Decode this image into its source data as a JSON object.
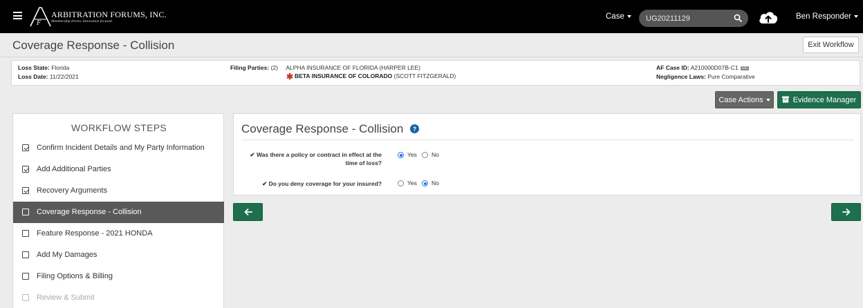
{
  "header": {
    "brand_name": "ARBITRATION FORUMS, INC.",
    "brand_tagline": "Membership driven. Innovation focused.",
    "case_menu_label": "Case",
    "search_value": "UG20211129",
    "user_menu_label": "Ben Responder"
  },
  "titlebar": {
    "title": "Coverage Response - Collision",
    "exit_label": "Exit Workflow"
  },
  "info": {
    "loss_state_label": "Loss State:",
    "loss_state_value": "Florida",
    "loss_date_label": "Loss Date:",
    "loss_date_value": "11/22/2021",
    "filing_parties_label": "Filing Parties:",
    "filing_parties_count": "(2)",
    "party1": "ALPHA INSURANCE OF FLORIDA",
    "party1_contact": "(HARPER LEE)",
    "party2": "BETA INSURANCE OF COLORADO",
    "party2_contact": "(SCOTT FITZGERALD)",
    "case_id_label": "AF Case ID:",
    "case_id_value": "A210000D07B-C1",
    "case_id_badge": "CC",
    "negligence_label": "Negligence Laws:",
    "negligence_value": "Pure Comparative"
  },
  "actions": {
    "case_actions_label": "Case Actions",
    "evidence_label": "Evidence Manager"
  },
  "sidebar": {
    "heading": "WORKFLOW STEPS",
    "steps": [
      {
        "label": "Confirm Incident Details and My Party Information",
        "checked": true
      },
      {
        "label": "Add Additional Parties",
        "checked": true
      },
      {
        "label": "Recovery Arguments",
        "checked": true
      },
      {
        "label": "Coverage Response - Collision",
        "checked": false,
        "active": true
      },
      {
        "label": "Feature Response - 2021 HONDA",
        "checked": false
      },
      {
        "label": "Add My Damages",
        "checked": false
      },
      {
        "label": "Filing Options & Billing",
        "checked": false
      },
      {
        "label": "Review & Submit",
        "checked": false,
        "disabled": true
      }
    ]
  },
  "panel": {
    "title": "Coverage Response - Collision",
    "q1_line1": "Was there a policy or contract in effect at the",
    "q1_line2": "time of loss?",
    "q1_answer": "Yes",
    "q2": "Do you deny coverage for your insured?",
    "q2_answer": "No",
    "yes_label": "Yes",
    "no_label": "No"
  },
  "colors": {
    "navbar": "#000000",
    "primary_green": "#1e6f4d",
    "active_step": "#595959",
    "radio_selected": "#1a73e8",
    "required_star": "#c0392b"
  }
}
